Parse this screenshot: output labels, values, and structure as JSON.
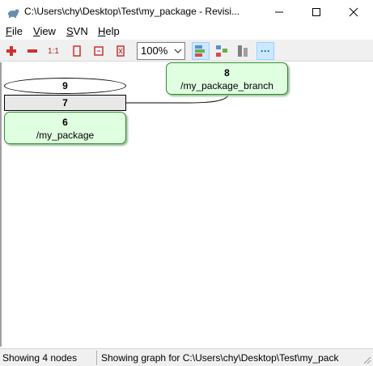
{
  "window": {
    "title": "C:\\Users\\chy\\Desktop\\Test\\my_package - Revisi..."
  },
  "menu": [
    {
      "key": "F",
      "rest": "ile"
    },
    {
      "key": "V",
      "rest": "iew"
    },
    {
      "key": "S",
      "rest": "VN"
    },
    {
      "key": "H",
      "rest": "elp"
    }
  ],
  "toolbar": {
    "zoom_value": "100%",
    "zoom_one_label": "1:1",
    "more_label": "···"
  },
  "icons": {
    "app": "tortoise-icon",
    "minimize": "minimize-icon",
    "maximize": "maximize-icon",
    "close": "close-icon"
  },
  "colors": {
    "node_green_bg": "#e0ffe0",
    "node_green_border": "#2e8b2e",
    "node_gray_bg": "#e8e8e8",
    "toolbar_bg": "#f0f0f0",
    "active_btn": "#cce8ff"
  },
  "graph": {
    "nodes": [
      {
        "rev": "8",
        "path": "/my_package_branch"
      },
      {
        "rev": "9",
        "path": ""
      },
      {
        "rev": "7",
        "path": ""
      },
      {
        "rev": "6",
        "path": "/my_package"
      }
    ]
  },
  "status": {
    "nodes": "Showing 4 nodes",
    "graph": "Showing graph for C:\\Users\\chy\\Desktop\\Test\\my_pack"
  }
}
